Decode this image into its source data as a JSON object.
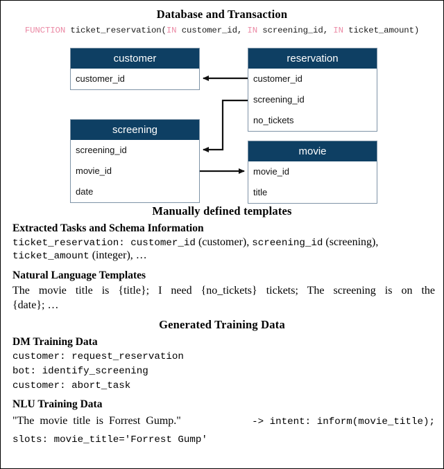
{
  "figure": {
    "border_color": "#000000",
    "accent_color": "#0e3f63",
    "keyword_color": "#eb8aa5"
  },
  "database_section": {
    "title": "Database and Transaction",
    "sql": {
      "kw_function": "FUNCTION",
      "fn_name": " ticket_reservation(",
      "kw_in_1": "IN",
      "arg_1": " customer_id, ",
      "kw_in_2": "IN",
      "arg_2": " screening_id, ",
      "kw_in_3": "IN",
      "arg_3": " ticket_amount)"
    },
    "tables": [
      {
        "name": "customer",
        "fields": [
          "customer_id"
        ]
      },
      {
        "name": "reservation",
        "fields": [
          "customer_id",
          "screening_id",
          "no_tickets"
        ]
      },
      {
        "name": "screening",
        "fields": [
          "screening_id",
          "movie_id",
          "date"
        ]
      },
      {
        "name": "movie",
        "fields": [
          "movie_id",
          "title"
        ]
      }
    ],
    "relations": [
      {
        "from": "reservation.customer_id",
        "to": "customer.customer_id"
      },
      {
        "from": "reservation.screening_id",
        "to": "screening.screening_id"
      },
      {
        "from": "screening.movie_id",
        "to": "movie.movie_id"
      }
    ]
  },
  "templates_section": {
    "title": "Manually defined templates",
    "extracted": {
      "heading": "Extracted Tasks and Schema Information",
      "line1_a": "ticket_reservation: customer_id",
      "line1_b": " (customer), ",
      "line1_c": "screening_id",
      "line1_d": " (screening),",
      "line2_a": "ticket_amount",
      "line2_b": " (integer), …"
    },
    "nl_templates": {
      "heading": "Natural Language Templates",
      "line1": "The movie title is {title}; I need {no_tickets} tickets; The screening is on the",
      "line2": "{date}; …"
    }
  },
  "generated_section": {
    "title": "Generated Training Data",
    "dm": {
      "heading": "DM Training Data",
      "lines": [
        "customer: request_reservation",
        "bot: identify_screening",
        "customer: abort_task"
      ]
    },
    "nlu": {
      "heading": "NLU Training Data",
      "line1_quote": "\"The movie title is Forrest Gump.\"",
      "line1_code": " -> intent: inform(movie_title);",
      "line2": "slots: movie_title='Forrest Gump'"
    }
  }
}
